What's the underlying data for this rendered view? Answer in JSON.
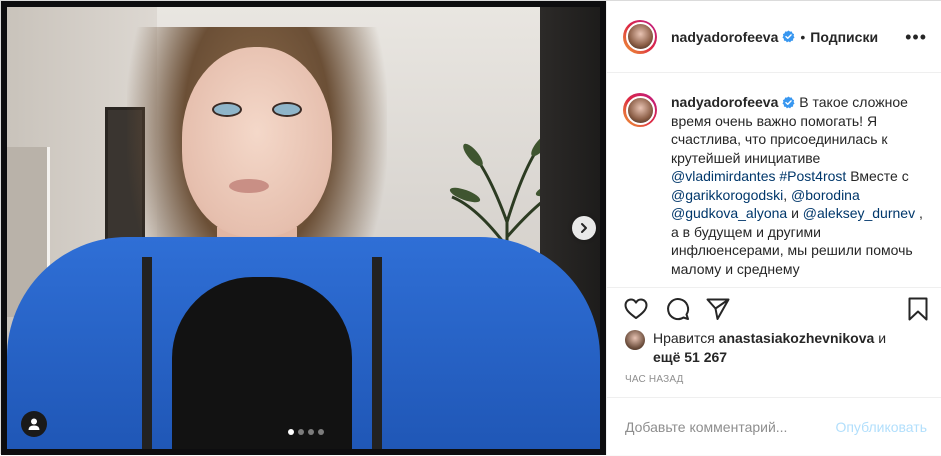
{
  "header": {
    "username": "nadyadorofeeva",
    "separator": "•",
    "follow_status": "Подписки",
    "more": "•••"
  },
  "caption": {
    "username": "nadyadorofeeva",
    "text1": " В такое сложное время очень важно помогать! Я счастлива, что присоединилась к крутейшей инициативе ",
    "mention1": "@vladimirdantes",
    "space1": " ",
    "hashtag": "#Post4rost",
    "text2": " Вместе с ",
    "mention2": "@garikkorogodski",
    "text3": ", ",
    "mention3": "@borodina",
    "space2": " ",
    "mention4": "@gudkova_alyona",
    "text4": " и ",
    "mention5": "@aleksey_durnev",
    "text5": " , а в будущем и другими инфлюенсерами, мы решили помочь малому и среднему"
  },
  "likes": {
    "prefix": "Нравится ",
    "user": "anastasiakozhevnikova",
    "mid": " и ",
    "others": "ещё 51 267"
  },
  "timestamp": "час назад",
  "comment": {
    "placeholder": "Добавьте комментарий...",
    "publish": "Опубликовать"
  },
  "carousel": {
    "slide_count": 4,
    "active_index": 0
  },
  "colors": {
    "link": "#00376b",
    "verified": "#3897f0",
    "publish_disabled": "#b2dffc"
  }
}
